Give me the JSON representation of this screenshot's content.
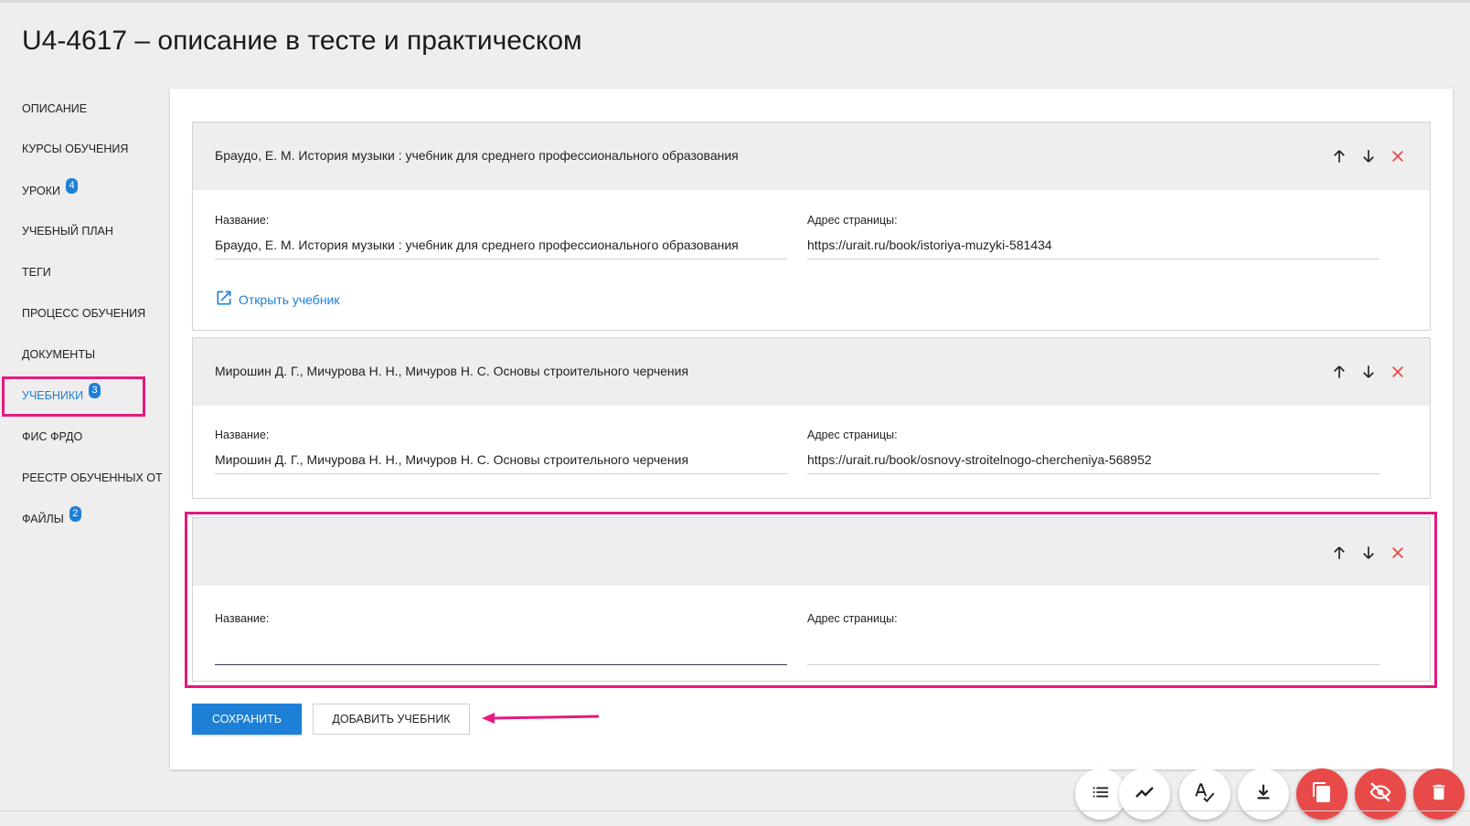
{
  "page": {
    "title": "U4-4617 – описание в тесте и практическом"
  },
  "sidebar": {
    "items": [
      {
        "label": "ОПИСАНИЕ"
      },
      {
        "label": "КУРСЫ ОБУЧЕНИЯ"
      },
      {
        "label": "УРОКИ",
        "badge": "4"
      },
      {
        "label": "УЧЕБНЫЙ ПЛАН"
      },
      {
        "label": "ТЕГИ"
      },
      {
        "label": "ПРОЦЕСС ОБУЧЕНИЯ"
      },
      {
        "label": "ДОКУМЕНТЫ"
      },
      {
        "label": "УЧЕБНИКИ",
        "badge": "3",
        "active": true
      },
      {
        "label": "ФИС ФРДО"
      },
      {
        "label": "РЕЕСТР ОБУЧЕННЫХ ОТ"
      },
      {
        "label": "ФАЙЛЫ",
        "badge": "2"
      }
    ]
  },
  "books": [
    {
      "header": "Браудо, Е. М. История музыки : учебник для среднего профессионального образования",
      "name_label": "Название:",
      "name_value": "Браудо, Е. М. История музыки : учебник для среднего профессионального образования",
      "url_label": "Адрес страницы:",
      "url_value": "https://urait.ru/book/istoriya-muzyki-581434",
      "open_link": "Открыть учебник"
    },
    {
      "header": "Мирошин Д. Г., Мичурова Н. Н., Мичуров Н. С. Основы строительного черчения",
      "name_label": "Название:",
      "name_value": "Мирошин Д. Г., Мичурова Н. Н., Мичуров Н. С.  Основы строительного черчения",
      "url_label": "Адрес страницы:",
      "url_value": "https://urait.ru/book/osnovy-stroitelnogo-chercheniya-568952"
    },
    {
      "header": "",
      "name_label": "Название:",
      "name_value": "",
      "url_label": "Адрес страницы:",
      "url_value": ""
    }
  ],
  "actions": {
    "save_label": "СОХРАНИТЬ",
    "add_label": "ДОБАВИТЬ УЧЕБНИК"
  },
  "fabs": [
    {
      "icon": "list-icon",
      "style": "white"
    },
    {
      "icon": "trend-icon",
      "style": "white"
    },
    {
      "icon": "spellcheck-icon",
      "style": "white"
    },
    {
      "icon": "download-icon",
      "style": "white"
    },
    {
      "icon": "copy-icon",
      "style": "red"
    },
    {
      "icon": "visibility-off-icon",
      "style": "red"
    },
    {
      "icon": "trash-icon",
      "style": "red"
    }
  ],
  "colors": {
    "accent": "#1e7fd6",
    "annotation": "#e6197e",
    "danger": "#e84a4a"
  }
}
